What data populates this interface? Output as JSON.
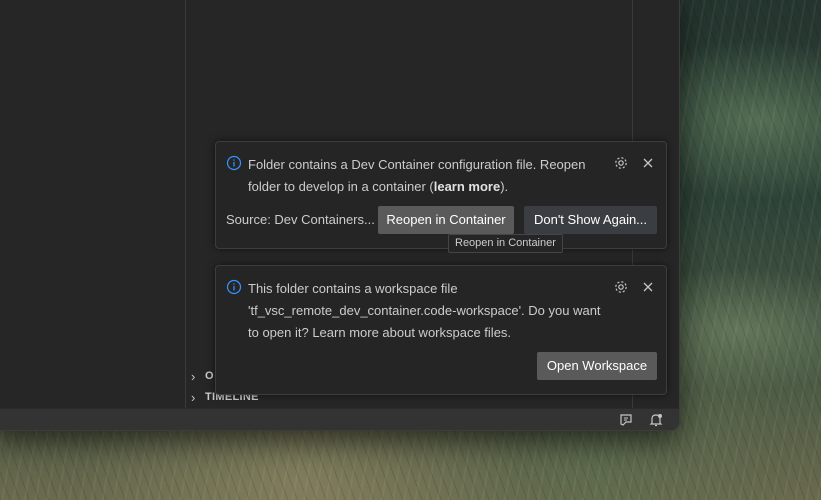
{
  "notifications": [
    {
      "message_prefix": "Folder contains a Dev Container configuration file. Reopen folder to develop in a container (",
      "message_link": "learn more",
      "message_suffix": ").",
      "source": "Source: Dev Containers...",
      "primary_button": "Reopen in Container",
      "secondary_button": "Don't Show Again..."
    },
    {
      "message": "This folder contains a workspace file 'tf_vsc_remote_dev_container.code-workspace'. Do you want to open it? Learn more about workspace files.",
      "primary_button": "Open Workspace"
    }
  ],
  "tooltip": "Reopen in Container",
  "sidebar_sections": [
    "O",
    "TIMELINE"
  ],
  "colors": {
    "info_icon": "#3794ff",
    "primary_button": "#5a5a5a",
    "secondary_button": "#3a3d41"
  },
  "icons": [
    "info-icon",
    "gear-icon",
    "close-icon",
    "chevron-right-icon",
    "feedback-icon",
    "bell-icon"
  ]
}
